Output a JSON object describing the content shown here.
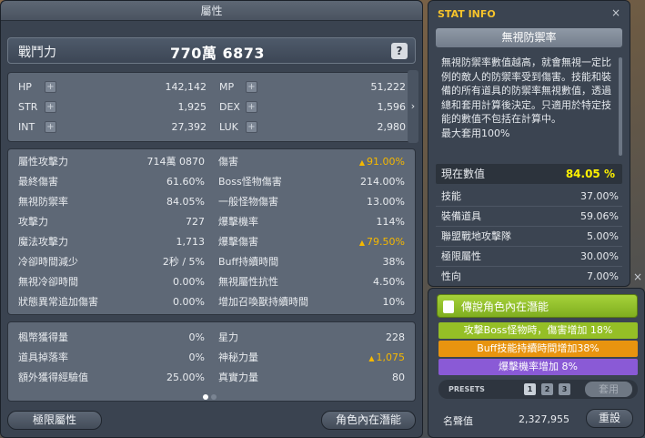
{
  "window_title": "屬性",
  "combat_power": {
    "label": "戰鬥力",
    "value": "770萬 6873"
  },
  "help_label": "?",
  "plus_glyph": "+",
  "primary_stats": {
    "hp": {
      "label": "HP",
      "value": "142,142"
    },
    "mp": {
      "label": "MP",
      "value": "51,222"
    },
    "str": {
      "label": "STR",
      "value": "1,925"
    },
    "dex": {
      "label": "DEX",
      "value": "1,596"
    },
    "int": {
      "label": "INT",
      "value": "27,392"
    },
    "luk": {
      "label": "LUK",
      "value": "2,980"
    }
  },
  "side_arrow": "›",
  "detail_left": [
    {
      "label": "屬性攻擊力",
      "value": "714萬 0870"
    },
    {
      "label": "最終傷害",
      "value": "61.60%"
    },
    {
      "label": "無視防禦率",
      "value": "84.05%"
    },
    {
      "label": "攻擊力",
      "value": "727"
    },
    {
      "label": "魔法攻擊力",
      "value": "1,713"
    },
    {
      "label": "冷卻時間減少",
      "value": "2秒 / 5%"
    },
    {
      "label": "無視冷卻時間",
      "value": "0.00%"
    },
    {
      "label": "狀態異常追加傷害",
      "value": "0.00%"
    }
  ],
  "detail_right": [
    {
      "label": "傷害",
      "value": "91.00%",
      "highlight": true
    },
    {
      "label": "Boss怪物傷害",
      "value": "214.00%"
    },
    {
      "label": "一般怪物傷害",
      "value": "13.00%"
    },
    {
      "label": "爆擊機率",
      "value": "114%"
    },
    {
      "label": "爆擊傷害",
      "value": "79.50%",
      "highlight": true
    },
    {
      "label": "Buff持續時間",
      "value": "38%"
    },
    {
      "label": "無視屬性抗性",
      "value": "4.50%"
    },
    {
      "label": "增加召喚獸持續時間",
      "value": "10%"
    }
  ],
  "misc_left": [
    {
      "label": "楓幣獲得量",
      "value": "0%"
    },
    {
      "label": "道具掉落率",
      "value": "0%"
    },
    {
      "label": "額外獲得經驗值",
      "value": "25.00%"
    }
  ],
  "misc_right": [
    {
      "label": "星力",
      "value": "228"
    },
    {
      "label": "神秘力量",
      "value": "1,075",
      "highlight": true
    },
    {
      "label": "真實力量",
      "value": "80"
    }
  ],
  "up_arrow": "▲",
  "pages": {
    "current": 1,
    "total": 2
  },
  "bottom_buttons": {
    "hyper_stat": "極限屬性",
    "inner_ability": "角色內在潛能"
  },
  "stat_info": {
    "title": "STAT INFO",
    "close": "×",
    "stat_name": "無視防禦率",
    "description": "無視防禦率數值越高，就會無視一定比例的敵人的防禦率受到傷害。技能和裝備的所有道具的防禦率無視數值，透過總和套用計算後決定。只適用於特定技能的數值不包括在計算中。",
    "max_note": "最大套用100%",
    "current_label": "現在數值",
    "current_value": "84.05 %",
    "breakdown": [
      {
        "label": "技能",
        "value": "37.00%"
      },
      {
        "label": "裝備道具",
        "value": "59.06%"
      },
      {
        "label": "聯盟戰地攻擊隊",
        "value": "5.00%"
      },
      {
        "label": "極限屬性",
        "value": "30.00%"
      },
      {
        "label": "性向",
        "value": "7.00%"
      }
    ]
  },
  "inner_ability": {
    "header": "傳說角色內在潛能",
    "lines": [
      {
        "text": "攻擊Boss怪物時，傷害增加 18%",
        "color": "#95bf26"
      },
      {
        "text": "Buff技能持續時間增加38%",
        "color": "#e8940f"
      },
      {
        "text": "爆擊機率增加 8%",
        "color": "#8a5ad6"
      }
    ],
    "presets_label": "PRESETS",
    "presets": [
      "1",
      "2",
      "3"
    ],
    "active_preset": 1,
    "apply_label": "套用",
    "fame_label": "名聲值",
    "fame_value": "2,327,955",
    "reset_label": "重設",
    "close": "×"
  }
}
